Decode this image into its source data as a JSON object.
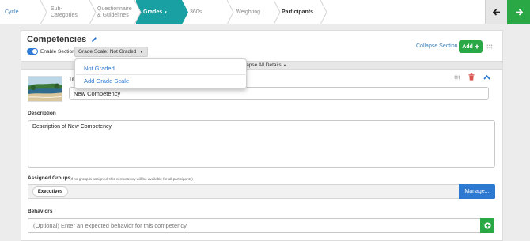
{
  "stepbar": {
    "steps": [
      {
        "label": "Cycle",
        "state": "done"
      },
      {
        "label": "Sub-\nCategories",
        "state": "pending"
      },
      {
        "label": "Questionnaire\n& Guidelines",
        "state": "pending"
      },
      {
        "label": "Grades",
        "state": "active"
      },
      {
        "label": "360s",
        "state": "pending"
      },
      {
        "label": "Weighting",
        "state": "pending"
      },
      {
        "label": "Participants",
        "state": "current-dark"
      }
    ],
    "active_caret": "▾",
    "back_icon": "arrow-left-icon",
    "next_icon": "arrow-right-icon",
    "next_color": "#2aa845"
  },
  "section": {
    "title": "Competencies",
    "edit_icon": "pencil-icon",
    "enable_label": "Enable Section",
    "enabled": true,
    "grade_scale_label": "Grade Scale: Not Graded",
    "collapse_section": "Collapse Section",
    "add_label": "Add",
    "collapse_all": "Collapse All Details"
  },
  "dropdown": {
    "options": [
      "Not Graded",
      "Add Grade Scale"
    ]
  },
  "competency": {
    "title_label": "Title",
    "title_value": "New Competency",
    "description_label": "Description",
    "description_value": "Description of New Competency",
    "groups_label": "Assigned Groups",
    "groups_note": "(If no group is assigned, this competency will be available for all participants)",
    "groups": [
      "Executives"
    ],
    "manage_label": "Manage...",
    "behaviors_label": "Behaviors",
    "behaviors_placeholder": "(Optional) Enter an expected behavior for this competency"
  },
  "colors": {
    "accent": "#19a0a2",
    "primary_blue": "#2d79d1",
    "success_green": "#2aa845",
    "delete_red": "#d9534f"
  }
}
